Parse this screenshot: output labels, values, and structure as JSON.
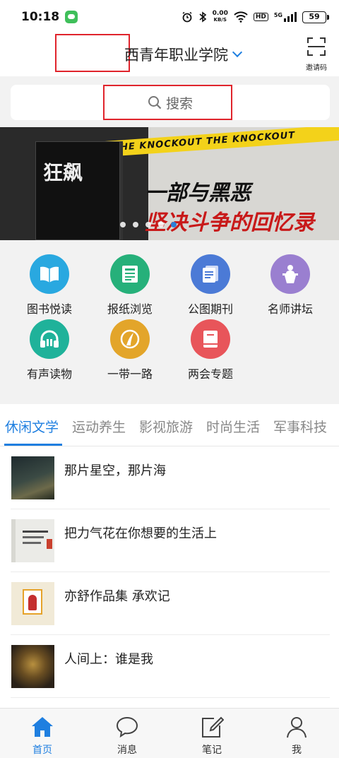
{
  "status_bar": {
    "time": "10:18",
    "speed": "0.00",
    "speed_unit": "KB/S",
    "hd": "HD",
    "network": "5G",
    "battery": "59"
  },
  "header": {
    "title": "西青年职业学院",
    "invite_label": "邀请码"
  },
  "search": {
    "placeholder": "搜索"
  },
  "banner": {
    "tape_text": "THE KNOCKOUT    THE KNOCKOUT",
    "book_title": "狂飙",
    "headline_1": "一部与黑恶",
    "headline_2": "坚决斗争的回忆录",
    "active_dot_index": 4,
    "dot_count": 5
  },
  "shortcuts": [
    {
      "label": "图书悦读",
      "icon": "book-open-icon",
      "color": "#29a8e0"
    },
    {
      "label": "报纸浏览",
      "icon": "newspaper-icon",
      "color": "#26b07a"
    },
    {
      "label": "公图期刊",
      "icon": "document-icon",
      "color": "#4b7ad6"
    },
    {
      "label": "名师讲坛",
      "icon": "podium-icon",
      "color": "#9a7fd0"
    },
    {
      "label": "有声读物",
      "icon": "headphones-icon",
      "color": "#1fb29a"
    },
    {
      "label": "一带一路",
      "icon": "belt-road-icon",
      "color": "#e3a52a"
    },
    {
      "label": "两会专题",
      "icon": "red-book-icon",
      "color": "#e8555a"
    }
  ],
  "tabs": [
    {
      "label": "休闲文学",
      "active": true
    },
    {
      "label": "运动养生",
      "active": false
    },
    {
      "label": "影视旅游",
      "active": false
    },
    {
      "label": "时尚生活",
      "active": false
    },
    {
      "label": "军事科技",
      "active": false
    }
  ],
  "articles": [
    {
      "title": "那片星空，那片海"
    },
    {
      "title": "把力气花在你想要的生活上"
    },
    {
      "title": "亦舒作品集 承欢记"
    },
    {
      "title": "人间上：谁是我"
    }
  ],
  "bottom_nav": [
    {
      "label": "首页",
      "icon": "home-icon",
      "active": true
    },
    {
      "label": "消息",
      "icon": "message-icon",
      "active": false
    },
    {
      "label": "笔记",
      "icon": "note-icon",
      "active": false
    },
    {
      "label": "我",
      "icon": "user-icon",
      "active": false
    }
  ],
  "colors": {
    "accent": "#1f7fe0",
    "highlight_box": "#e0242c"
  }
}
